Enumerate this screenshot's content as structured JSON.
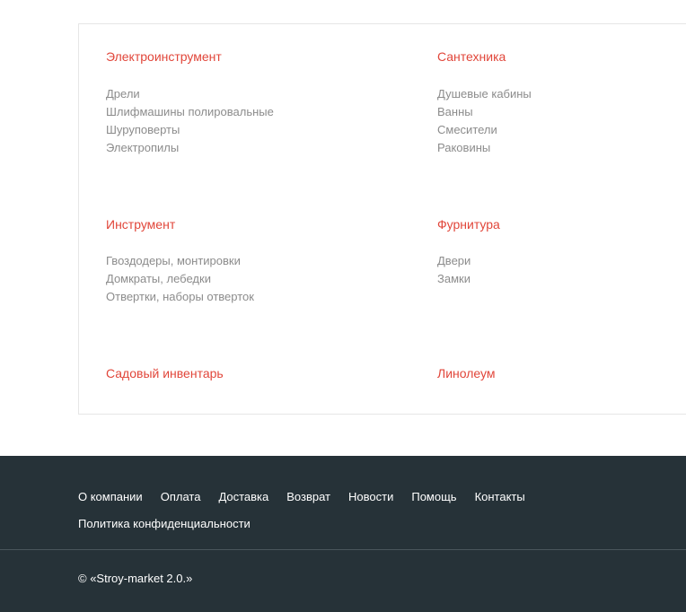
{
  "catalog": {
    "categories": [
      {
        "title": "Электроинструмент",
        "items": [
          "Дрели",
          "Шлифмашины полировальные",
          "Шуруповерты",
          "Электропилы"
        ]
      },
      {
        "title": "Сантехника",
        "items": [
          "Душевые кабины",
          "Ванны",
          "Смесители",
          "Раковины"
        ]
      },
      {
        "title": "Инструмент",
        "items": [
          "Гвоздодеры, монтировки",
          "Домкраты, лебедки",
          "Отвертки, наборы отверток"
        ]
      },
      {
        "title": "Фурнитура",
        "items": [
          "Двери",
          "Замки"
        ]
      },
      {
        "title": "Садовый инвентарь",
        "items": []
      },
      {
        "title": "Линолеум",
        "items": []
      }
    ]
  },
  "footer": {
    "links": [
      "О компании",
      "Оплата",
      "Доставка",
      "Возврат",
      "Новости",
      "Помощь",
      "Контакты",
      "Политика конфиденциальности"
    ],
    "copyright": "© «Stroy-market 2.0.»"
  },
  "colors": {
    "category_title": "#e1463a",
    "subcategory_text": "#8c8c8c",
    "footer_background": "#263238",
    "footer_text": "#ffffff"
  }
}
